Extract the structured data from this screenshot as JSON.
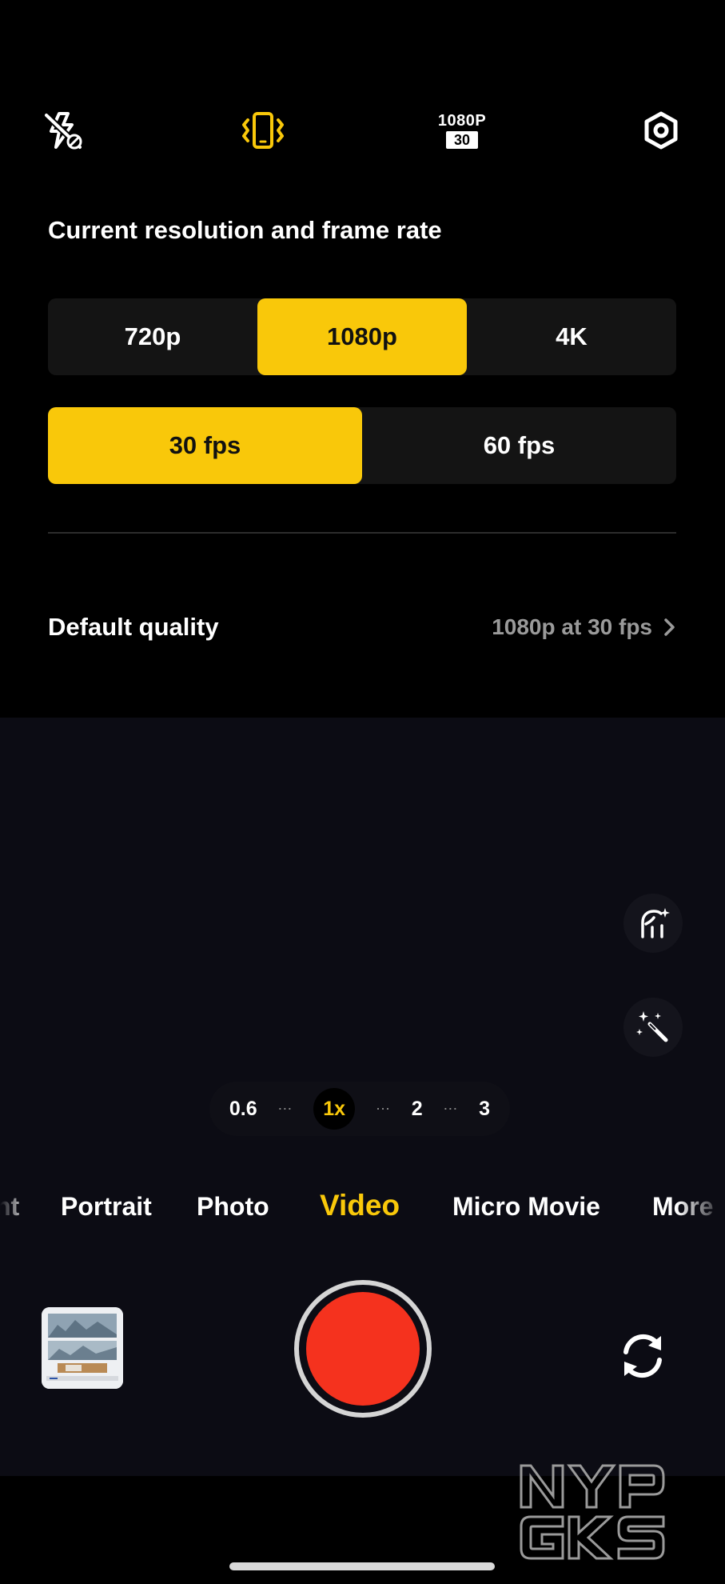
{
  "toolbar": {
    "flash_icon": "flash-off-icon",
    "stabilization_icon": "vibrate-phone-icon",
    "resolution_badge_top": "1080P",
    "resolution_badge_bottom": "30",
    "settings_icon": "settings-hexagon-icon"
  },
  "resolution_panel": {
    "title": "Current resolution and frame rate",
    "resolutions": [
      "720p",
      "1080p",
      "4K"
    ],
    "selected_resolution": "1080p",
    "frame_rates": [
      "30 fps",
      "60 fps"
    ],
    "selected_frame_rate": "30 fps",
    "default_quality_label": "Default quality",
    "default_quality_value": "1080p at 30 fps"
  },
  "zoom": {
    "levels": [
      "0.6",
      "1x",
      "2",
      "3"
    ],
    "selected": "1x",
    "separator": "⋯"
  },
  "modes": {
    "partial_left": "nt",
    "items": [
      "Portrait",
      "Photo",
      "Video",
      "Micro Movie",
      "More"
    ],
    "selected": "Video"
  },
  "watermark": {
    "line1": "NYP",
    "line2": "GKS"
  },
  "colors": {
    "accent": "#f9c80a",
    "record": "#f5321e",
    "panel_bg": "#000000",
    "segment_bg": "#141414",
    "muted_text": "#9a9a9a"
  }
}
